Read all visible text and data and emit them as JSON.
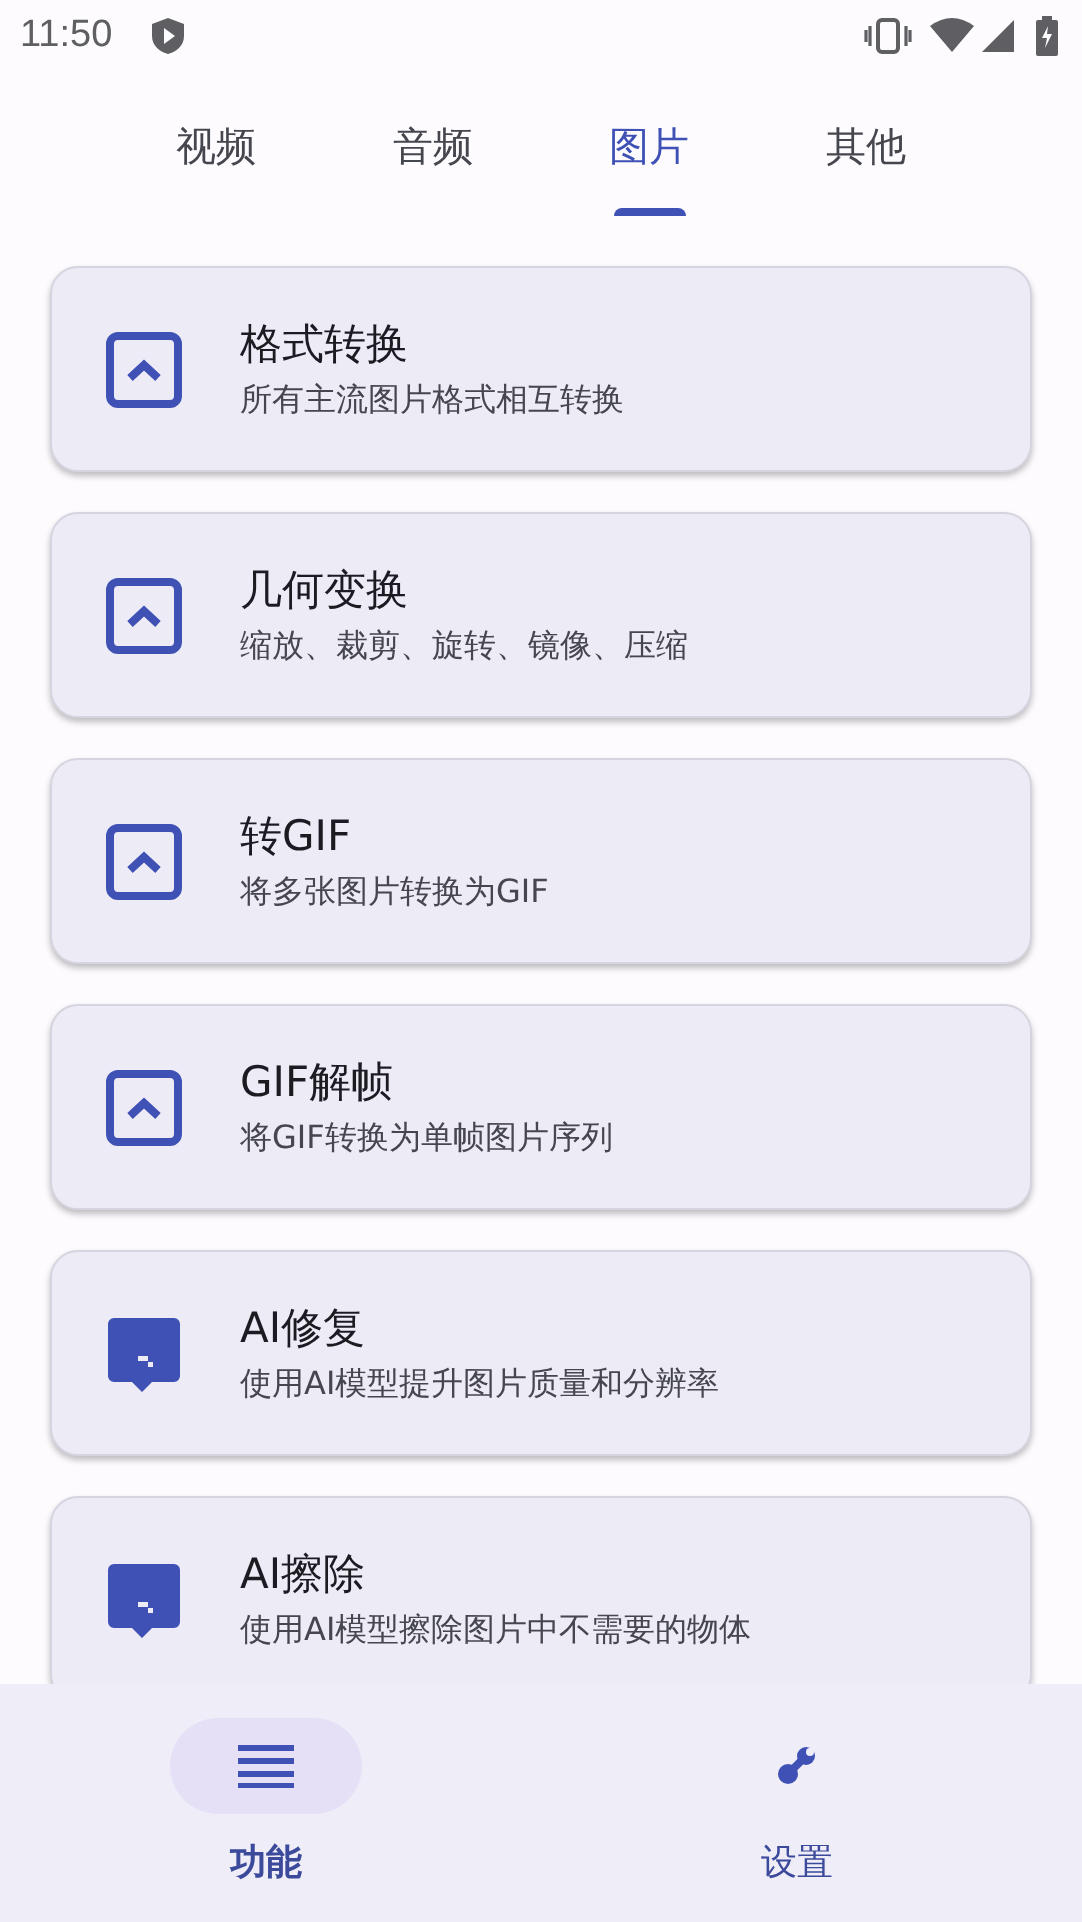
{
  "status_bar": {
    "time": "11:50"
  },
  "tabs": [
    {
      "label": "视频",
      "selected": false
    },
    {
      "label": "音频",
      "selected": false
    },
    {
      "label": "图片",
      "selected": true
    },
    {
      "label": "其他",
      "selected": false
    }
  ],
  "tools": [
    {
      "kind": "image",
      "title": "格式转换",
      "subtitle": "所有主流图片格式相互转换"
    },
    {
      "kind": "image",
      "title": "几何变换",
      "subtitle": "缩放、裁剪、旋转、镜像、压缩"
    },
    {
      "kind": "image",
      "title": "转GIF",
      "subtitle": "将多张图片转换为GIF"
    },
    {
      "kind": "image",
      "title": "GIF解帧",
      "subtitle": "将GIF转换为单帧图片序列"
    },
    {
      "kind": "ai",
      "title": "AI修复",
      "subtitle": "使用AI模型提升图片质量和分辨率"
    },
    {
      "kind": "ai",
      "title": "AI擦除",
      "subtitle": "使用AI模型擦除图片中不需要的物体"
    }
  ],
  "bottom_nav": [
    {
      "kind": "menu",
      "label": "功能",
      "selected": true
    },
    {
      "kind": "settings",
      "label": "设置",
      "selected": false
    }
  ]
}
